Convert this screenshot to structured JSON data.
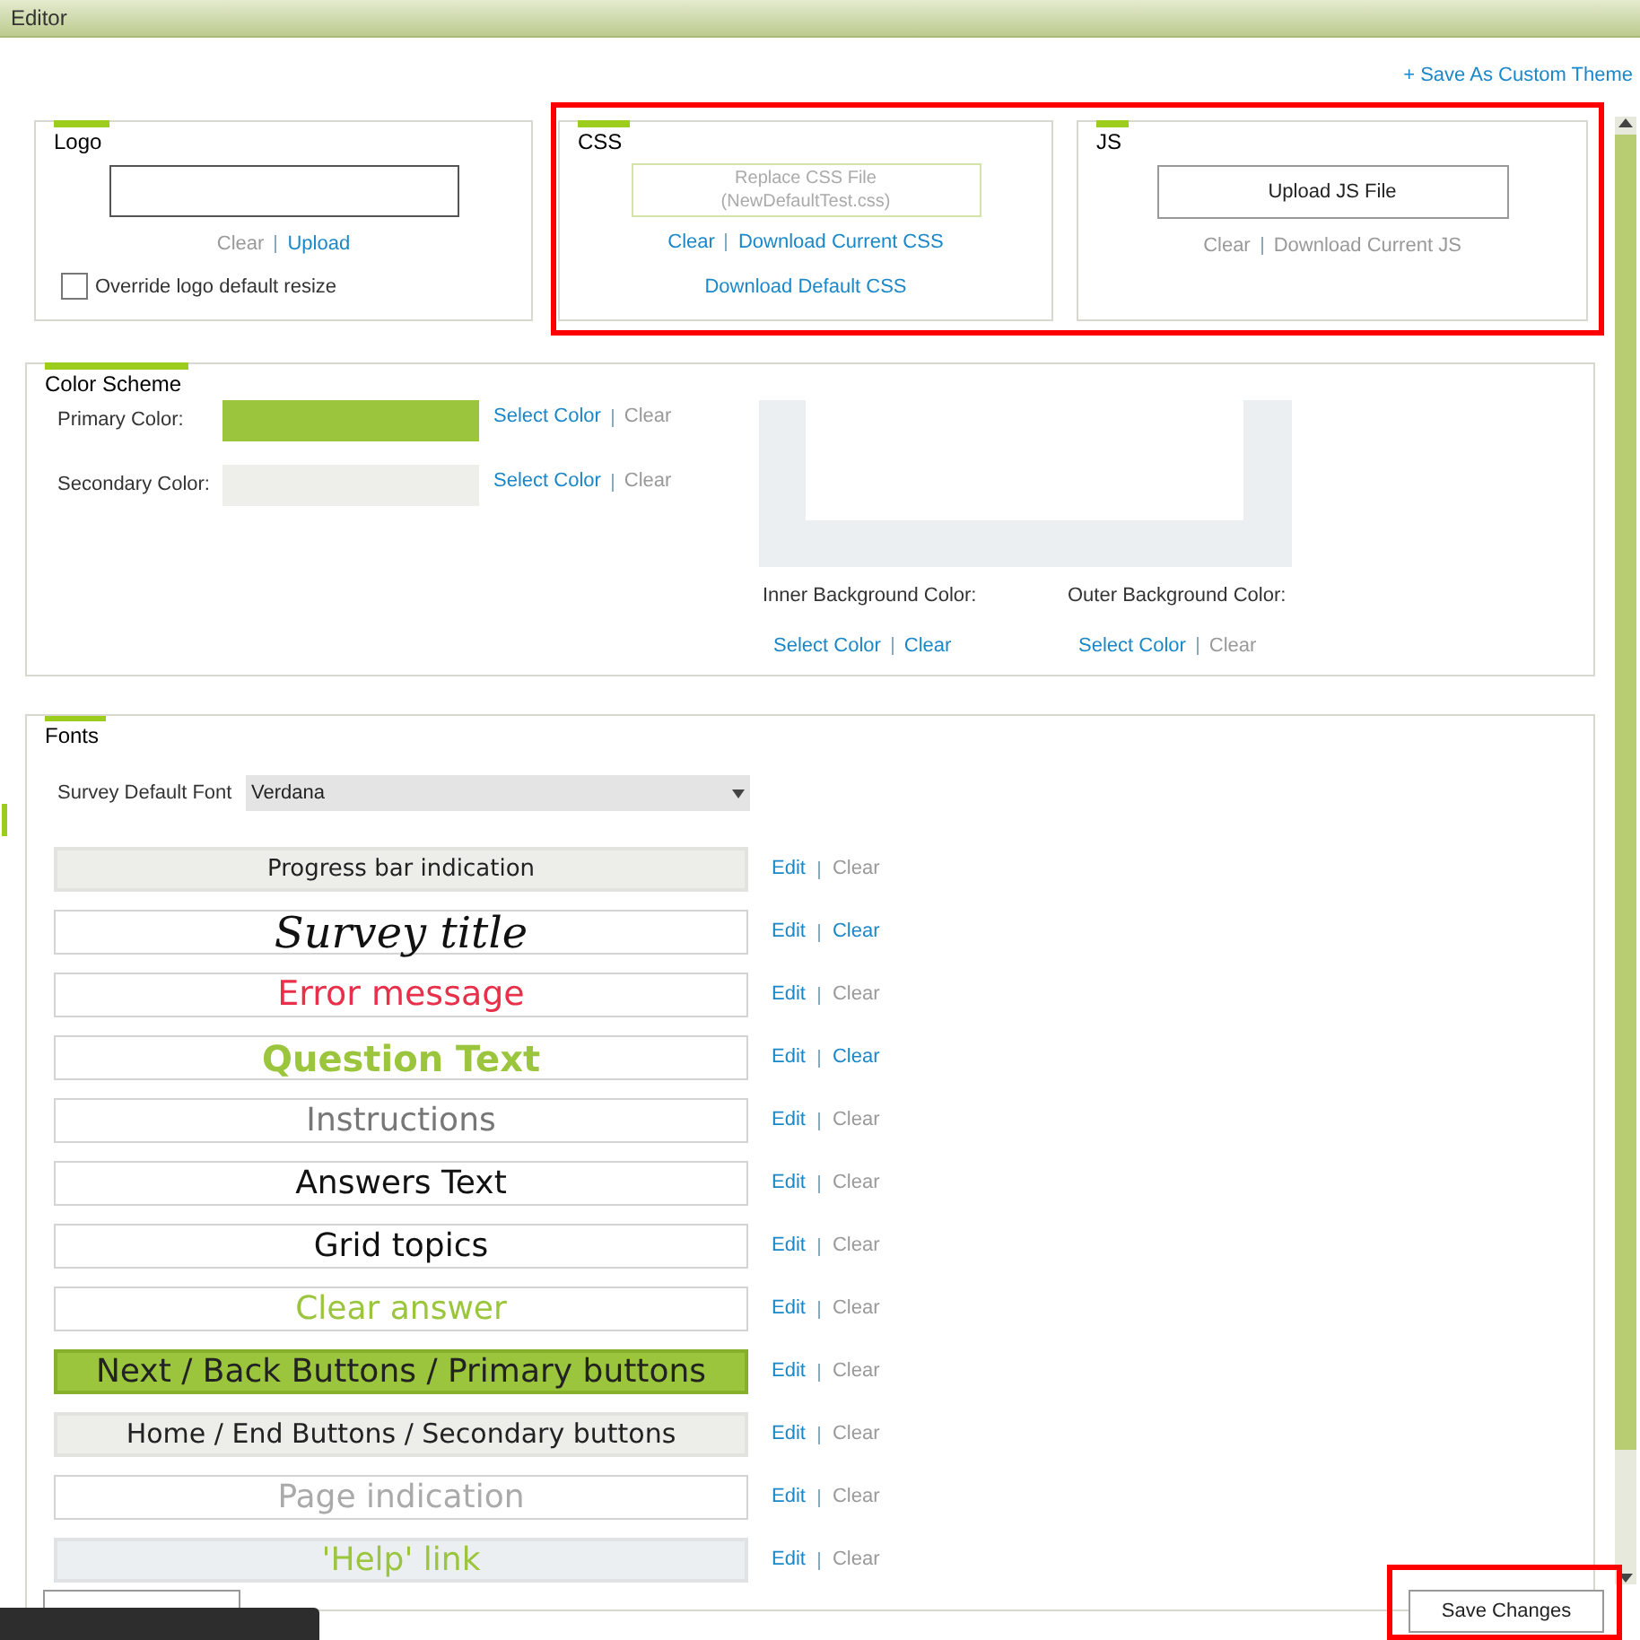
{
  "window": {
    "title": "Editor"
  },
  "save_as_custom_theme": "+ Save As Custom Theme",
  "logo": {
    "title": "Logo",
    "links": [
      {
        "label": "Clear",
        "enabled": false
      },
      {
        "label": "Upload",
        "enabled": true
      }
    ],
    "override": {
      "label": "Override logo default resize",
      "checked": false
    }
  },
  "css": {
    "title": "CSS",
    "button": {
      "lines": [
        "Replace CSS File",
        "(NewDefaultTest.css)"
      ],
      "disabled": true
    },
    "links": [
      {
        "label": "Clear",
        "enabled": true
      },
      {
        "label": "Download Current CSS",
        "enabled": true
      }
    ],
    "download_default": "Download Default CSS"
  },
  "js": {
    "title": "JS",
    "button": {
      "label": "Upload JS File"
    },
    "links": [
      {
        "label": "Clear",
        "enabled": false
      },
      {
        "label": "Download Current JS",
        "enabled": false
      }
    ]
  },
  "color_scheme": {
    "title": "Color Scheme",
    "colors": [
      {
        "label": "Primary Color:",
        "color": "#9bc53d",
        "links": [
          {
            "label": "Select Color",
            "enabled": true
          },
          {
            "label": "Clear",
            "enabled": false
          }
        ]
      },
      {
        "label": "Secondary Color:",
        "color": "#eeeeea",
        "links": [
          {
            "label": "Select Color",
            "enabled": true
          },
          {
            "label": "Clear",
            "enabled": false
          }
        ]
      }
    ],
    "backgrounds": [
      {
        "label": "Inner Background Color:",
        "links": [
          {
            "label": "Select Color",
            "enabled": true
          },
          {
            "label": "Clear",
            "enabled": true
          }
        ]
      },
      {
        "label": "Outer Background Color:",
        "links": [
          {
            "label": "Select Color",
            "enabled": true
          },
          {
            "label": "Clear",
            "enabled": false
          }
        ]
      }
    ]
  },
  "fonts": {
    "title": "Fonts",
    "default_font": {
      "label": "Survey Default Font",
      "value": "Verdana"
    },
    "items": [
      {
        "kind": "progress",
        "text": "Progress bar indication",
        "edit": "Edit",
        "clear": "Clear",
        "clear_enabled": false
      },
      {
        "kind": "title",
        "text": "Survey title",
        "edit": "Edit",
        "clear": "Clear",
        "clear_enabled": true
      },
      {
        "kind": "error",
        "text": "Error message",
        "edit": "Edit",
        "clear": "Clear",
        "clear_enabled": false
      },
      {
        "kind": "question",
        "text": "Question Text",
        "edit": "Edit",
        "clear": "Clear",
        "clear_enabled": true
      },
      {
        "kind": "instructions",
        "text": "Instructions",
        "edit": "Edit",
        "clear": "Clear",
        "clear_enabled": false
      },
      {
        "kind": "answers",
        "text": "Answers Text",
        "edit": "Edit",
        "clear": "Clear",
        "clear_enabled": false
      },
      {
        "kind": "grid",
        "text": "Grid topics",
        "edit": "Edit",
        "clear": "Clear",
        "clear_enabled": false
      },
      {
        "kind": "clear_answer",
        "text": "Clear answer",
        "edit": "Edit",
        "clear": "Clear",
        "clear_enabled": false
      },
      {
        "kind": "primary",
        "text": "Next / Back Buttons / Primary buttons",
        "edit": "Edit",
        "clear": "Clear",
        "clear_enabled": false
      },
      {
        "kind": "secondary",
        "text": "Home / End Buttons / Secondary buttons",
        "edit": "Edit",
        "clear": "Clear",
        "clear_enabled": false
      },
      {
        "kind": "page",
        "text": "Page indication",
        "edit": "Edit",
        "clear": "Clear",
        "clear_enabled": false
      },
      {
        "kind": "help",
        "text": "'Help' link",
        "edit": "Edit",
        "clear": "Clear",
        "clear_enabled": false
      }
    ]
  },
  "save_button": "Save Changes"
}
